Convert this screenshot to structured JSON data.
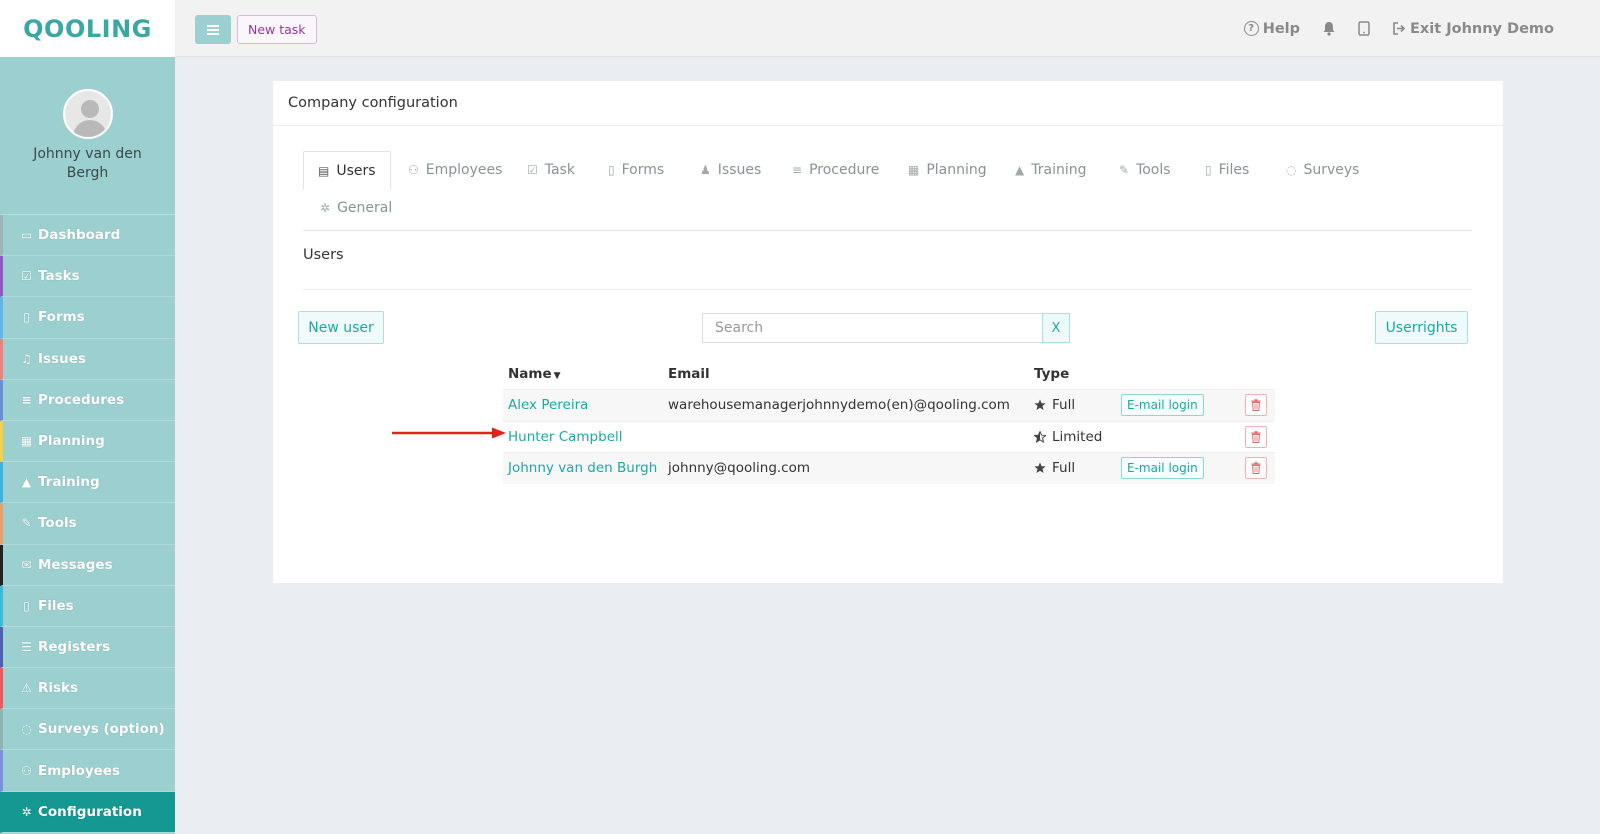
{
  "app": {
    "logo": "QOOLING"
  },
  "profile": {
    "name": "Johnny van den Bergh"
  },
  "sidebar": {
    "items": [
      {
        "label": "Dashboard",
        "icon": "monitor-icon",
        "glyph": "▭",
        "accent": "#9ab6b6"
      },
      {
        "label": "Tasks",
        "icon": "check-square-icon",
        "glyph": "☑",
        "accent": "#8e5ac7"
      },
      {
        "label": "Forms",
        "icon": "file-icon",
        "glyph": "▯",
        "accent": "#5db7e8"
      },
      {
        "label": "Issues",
        "icon": "bell-icon",
        "glyph": "♫",
        "accent": "#ee8080"
      },
      {
        "label": "Procedures",
        "icon": "list-icon",
        "glyph": "≡",
        "accent": "#6a8fd6"
      },
      {
        "label": "Planning",
        "icon": "calendar-icon",
        "glyph": "▦",
        "accent": "#f2d04a"
      },
      {
        "label": "Training",
        "icon": "graduation-cap-icon",
        "glyph": "▲",
        "accent": "#39b4e0"
      },
      {
        "label": "Tools",
        "icon": "wrench-icon",
        "glyph": "✎",
        "accent": "#e9a16b"
      },
      {
        "label": "Messages",
        "icon": "envelope-icon",
        "glyph": "✉",
        "accent": "#222222"
      },
      {
        "label": "Files",
        "icon": "file-pdf-icon",
        "glyph": "▯",
        "accent": "#3bbcd6"
      },
      {
        "label": "Registers",
        "icon": "list-lines-icon",
        "glyph": "☰",
        "accent": "#4d5fb3"
      },
      {
        "label": "Risks",
        "icon": "warning-icon",
        "glyph": "⚠",
        "accent": "#ee5a5a"
      },
      {
        "label": "Surveys (option)",
        "icon": "speech-bubble-icon",
        "glyph": "◌",
        "accent": "#8db3b3"
      },
      {
        "label": "Employees",
        "icon": "users-icon",
        "glyph": "⚇",
        "accent": "#7a8fe0"
      },
      {
        "label": "Configuration",
        "icon": "gear-icon",
        "glyph": "✲",
        "accent": "#159891",
        "active": true
      }
    ]
  },
  "topbar": {
    "new_task": "New task",
    "help": "Help",
    "exit": "Exit Johnny Demo"
  },
  "panel": {
    "title": "Company configuration"
  },
  "tabs": [
    {
      "label": "Users",
      "icon": "id-card-icon",
      "glyph": "▤",
      "active": true
    },
    {
      "label": "Employees",
      "icon": "users-icon",
      "glyph": "⚇"
    },
    {
      "label": "Task",
      "icon": "check-icon",
      "glyph": "☑"
    },
    {
      "label": "Forms",
      "icon": "file-icon",
      "glyph": "▯"
    },
    {
      "label": "Issues",
      "icon": "bell-icon",
      "glyph": "♟"
    },
    {
      "label": "Procedure",
      "icon": "list-icon",
      "glyph": "≡"
    },
    {
      "label": "Planning",
      "icon": "calendar-icon",
      "glyph": "▦"
    },
    {
      "label": "Training",
      "icon": "graduation-cap-icon",
      "glyph": "▲"
    },
    {
      "label": "Tools",
      "icon": "wrench-icon",
      "glyph": "✎"
    },
    {
      "label": "Files",
      "icon": "file-icon",
      "glyph": "▯"
    },
    {
      "label": "Surveys",
      "icon": "speech-bubble-icon",
      "glyph": "◌"
    },
    {
      "label": "General",
      "icon": "gear-icon",
      "glyph": "✲"
    }
  ],
  "users": {
    "section_title": "Users",
    "new_user": "New user",
    "search_placeholder": "Search",
    "search_clear": "X",
    "userrights": "Userrights",
    "columns": {
      "name": "Name",
      "email": "Email",
      "type": "Type"
    },
    "rows": [
      {
        "name": "Alex Pereira",
        "email": "warehousemanagerjohnnydemo(en)@qooling.com",
        "type": "Full",
        "type_icon": "star-icon",
        "email_login": "E-mail login"
      },
      {
        "name": "Hunter Campbell",
        "email": "",
        "type": "Limited",
        "type_icon": "half-star-icon",
        "email_login": ""
      },
      {
        "name": "Johnny van den Burgh",
        "email": "johnny@qooling.com",
        "type": "Full",
        "type_icon": "star-icon",
        "email_login": "E-mail login"
      }
    ]
  },
  "colors": {
    "teal": "#1aa9a4",
    "sidebar_bg": "#9ccfcf",
    "active_nav": "#159891",
    "arrow": "#e0241b"
  }
}
